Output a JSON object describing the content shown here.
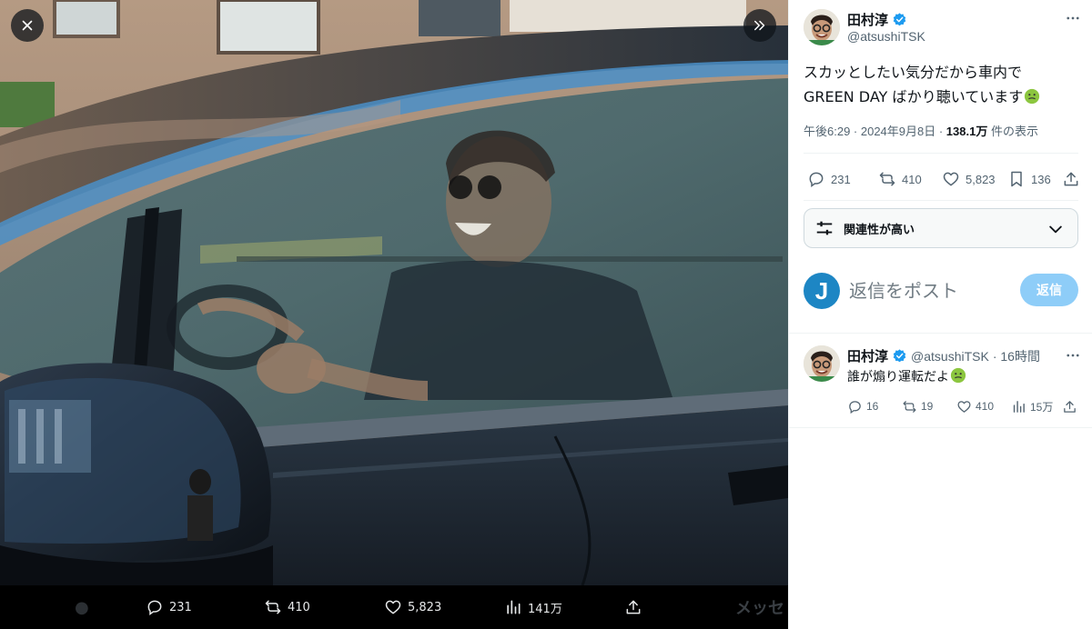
{
  "viewer": {
    "close_icon": "close-icon",
    "next_icon": "double-chevron-right-icon",
    "actions": {
      "reply_count": "231",
      "repost_count": "410",
      "like_count": "5,823",
      "views_count": "141万"
    },
    "partial_background_text": "メッセ"
  },
  "post": {
    "author_name": "田村淳",
    "author_handle": "@atsushiTSK",
    "text_line1": "スカッとしたい気分だから車内で",
    "text_line2": "GREEN DAY ばかり聴いています",
    "time": "午後6:29 · 2024年9月8日 · ",
    "views_value": "138.1万",
    "views_label": " 件の表示",
    "stats": {
      "replies": "231",
      "reposts": "410",
      "likes": "5,823",
      "bookmarks": "136"
    }
  },
  "relevance": {
    "label": "関連性が高い"
  },
  "reply_composer": {
    "avatar_letter": "J",
    "placeholder": "返信をポスト",
    "button_label": "返信"
  },
  "reply": {
    "author_name": "田村淳",
    "author_handle": "@atsushiTSK",
    "time": "· 16時間",
    "text": "誰が煽り運転だよ",
    "stats": {
      "replies": "16",
      "reposts": "19",
      "likes": "410",
      "views": "15万"
    }
  },
  "colors": {
    "accent": "#1d9bf0",
    "reply_button_disabled": "#8ecdf8",
    "text_secondary": "#536471"
  }
}
